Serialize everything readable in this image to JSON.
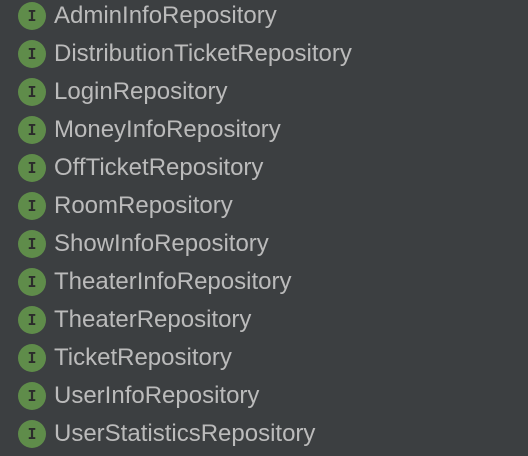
{
  "tree": {
    "icon_letter": "I",
    "icon_color": "#5f8c4a",
    "text_color": "#bbbbbb",
    "background": "#3c3f41",
    "items": [
      {
        "label": "AdminInfoRepository",
        "icon": "interface-icon"
      },
      {
        "label": "DistributionTicketRepository",
        "icon": "interface-icon"
      },
      {
        "label": "LoginRepository",
        "icon": "interface-icon"
      },
      {
        "label": "MoneyInfoRepository",
        "icon": "interface-icon"
      },
      {
        "label": "OffTicketRepository",
        "icon": "interface-icon"
      },
      {
        "label": "RoomRepository",
        "icon": "interface-icon"
      },
      {
        "label": "ShowInfoRepository",
        "icon": "interface-icon"
      },
      {
        "label": "TheaterInfoRepository",
        "icon": "interface-icon"
      },
      {
        "label": "TheaterRepository",
        "icon": "interface-icon"
      },
      {
        "label": "TicketRepository",
        "icon": "interface-icon"
      },
      {
        "label": "UserInfoRepository",
        "icon": "interface-icon"
      },
      {
        "label": "UserStatisticsRepository",
        "icon": "interface-icon"
      }
    ]
  }
}
